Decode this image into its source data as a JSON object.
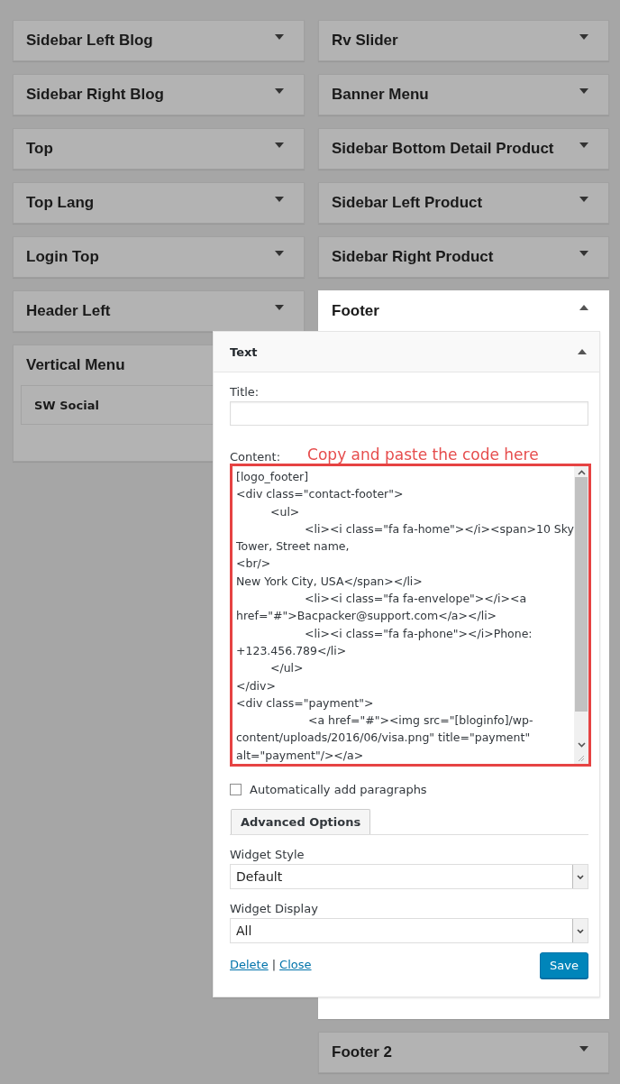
{
  "left_sidebars": [
    {
      "title": "Sidebar Left Blog",
      "expanded": false,
      "active": false
    },
    {
      "title": "Sidebar Right Blog",
      "expanded": false,
      "active": false
    },
    {
      "title": "Top",
      "expanded": false,
      "active": false
    },
    {
      "title": "Top Lang",
      "expanded": false,
      "active": false
    },
    {
      "title": "Login Top",
      "expanded": false,
      "active": false
    },
    {
      "title": "Header Left",
      "expanded": false,
      "active": false
    },
    {
      "title": "Vertical Menu",
      "expanded": true,
      "active": false,
      "widgets": [
        {
          "title": "SW Social"
        }
      ]
    }
  ],
  "right_sidebars": [
    {
      "title": "Rv Slider",
      "expanded": false,
      "active": false
    },
    {
      "title": "Banner Menu",
      "expanded": false,
      "active": false
    },
    {
      "title": "Sidebar Bottom Detail Product",
      "expanded": false,
      "active": false
    },
    {
      "title": "Sidebar Left Product",
      "expanded": false,
      "active": false
    },
    {
      "title": "Sidebar Right Product",
      "expanded": false,
      "active": false
    },
    {
      "title": "Footer",
      "expanded": true,
      "active": true
    },
    {
      "title": "Footer 2",
      "expanded": false,
      "active": false
    }
  ],
  "open_widget": {
    "title": "Text",
    "expanded": true,
    "title_field": {
      "label": "Title:"
    },
    "content_field": {
      "label": "Content:",
      "annotation": "Copy and paste the code here",
      "value": "[logo_footer]\n<div class=\"contact-footer\">\n\t<ul>\n\t\t<li><i class=\"fa fa-home\"></i><span>10 Sky\nTower, Street name,\n<br/>\nNew York City, USA</span></li>\n\t\t<li><i class=\"fa fa-envelope\"></i><a\nhref=\"#\">Bacpacker@support.com</a></li>\n\t\t<li><i class=\"fa fa-phone\"></i>Phone:\n+123.456.789</li>\n\t</ul>\n</div>\n<div class=\"payment\">\n\t\t <a href=\"#\"><img src=\"[bloginfo]/wp-\ncontent/uploads/2016/06/visa.png\" title=\"payment\"\nalt=\"payment\"/></a>"
    },
    "auto_paragraphs": {
      "label": "Automatically add paragraphs",
      "checked": false
    },
    "advanced_button": "Advanced Options",
    "selects": [
      {
        "label": "Widget Style",
        "value": "Default"
      },
      {
        "label": "Widget Display",
        "value": "All"
      }
    ],
    "links": [
      "Delete",
      "Close"
    ],
    "separator": "|",
    "save_button": "Save"
  }
}
